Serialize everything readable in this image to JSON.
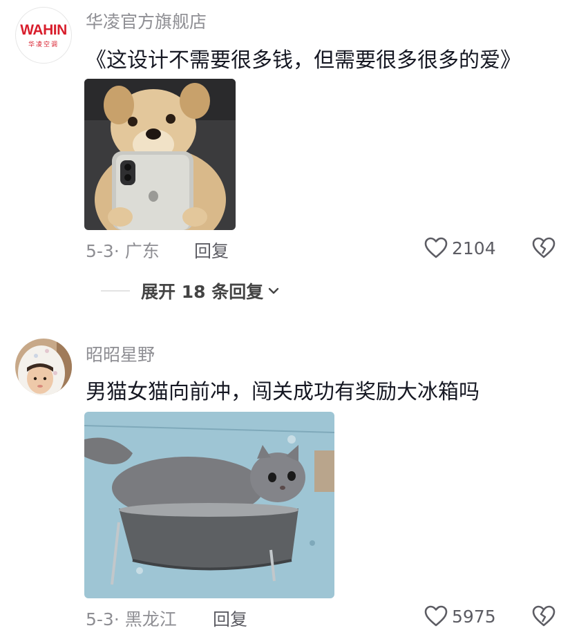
{
  "comments": [
    {
      "avatar_logo": "WAHIN",
      "avatar_subtext": "华凌空调",
      "username": "华凌官方旗舰店",
      "text": "《这设计不需要很多钱，但需要很多很多的爱》",
      "image_desc_icon": "dog-holding-phone-photo",
      "meta": "5-3· 广东",
      "reply_label": "回复",
      "likes": "2104",
      "like_icon": "heart-outline-icon",
      "dislike_icon": "broken-heart-icon",
      "expand_label": "展开 18 条回复"
    },
    {
      "username": "昭昭星野",
      "text": "男猫女猫向前冲，闯关成功有奖励大冰箱吗",
      "image_desc_icon": "cat-in-bowl-photo",
      "meta": "5-3· 黑龙江",
      "reply_label": "回复",
      "likes": "5975",
      "like_icon": "heart-outline-icon",
      "dislike_icon": "broken-heart-icon"
    }
  ],
  "colors": {
    "brand_red": "#d81e2c",
    "meta_gray": "#8e8e93",
    "text_dark": "#161823"
  }
}
